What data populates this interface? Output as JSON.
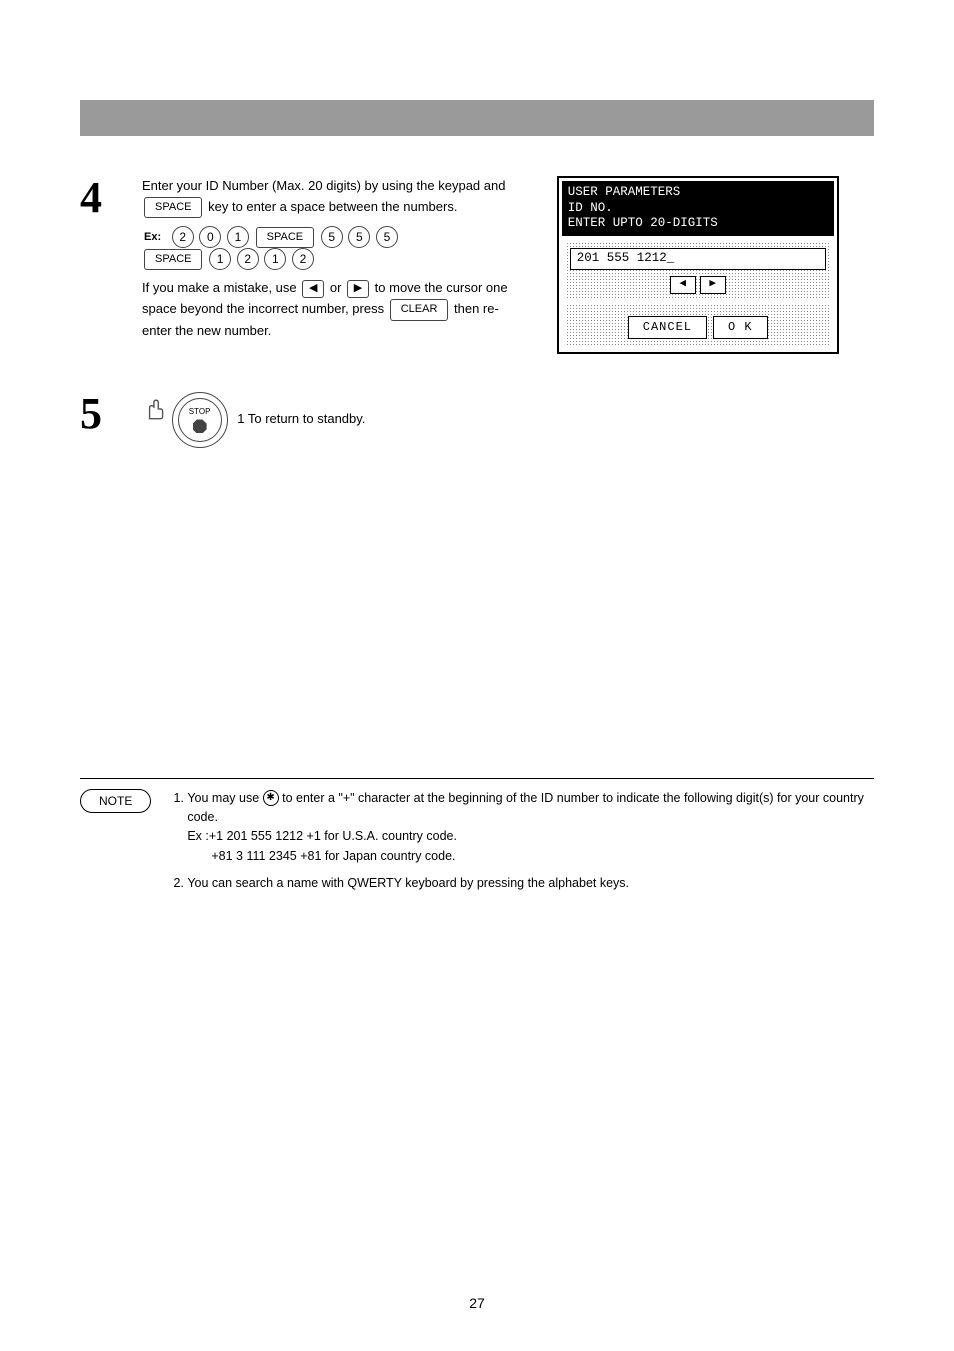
{
  "step4": {
    "num": "4",
    "line1_a": "Enter your ID Number (Max. 20 digits) by using the keypad and ",
    "space_btn": "SPACE",
    "line1_b": " key to enter a space between the numbers.",
    "ex_prefix": "Ex:",
    "k1": "2",
    "k2": "0",
    "k3": "1",
    "k4": "5",
    "k5": "5",
    "k6": "5",
    "k7": "1",
    "k8": "2",
    "k9": "1",
    "k10": "2",
    "line2_a": "If you make a mistake, use ",
    "line2_b": " or ",
    "line2_c": " to move the cursor one space beyond the incorrect number, press ",
    "clear_btn": "CLEAR",
    "line2_d": " then re-enter the new number."
  },
  "step5": {
    "num": "5",
    "text": "1 To return to standby."
  },
  "lcd": {
    "h1": "USER PARAMETERS",
    "h2": "ID NO.",
    "h3": "ENTER UPTO 20-DIGITS",
    "value": "201 555 1212_",
    "cancel": "CANCEL",
    "ok": "O K"
  },
  "note": {
    "label": "NOTE",
    "li1_a": "You may use ",
    "li1_b": " to enter a \"+\" character at the beginning of the ID number to indicate the following digit(s) for your country code.",
    "li1_c": "Ex :+1 201 555 1212 +1 for U.S.A. country code.",
    "li1_d": "+81 3 111 2345 +81 for Japan country code.",
    "li2": "You can search a name with QWERTY keyboard by pressing the alphabet keys."
  },
  "page_num": "27"
}
